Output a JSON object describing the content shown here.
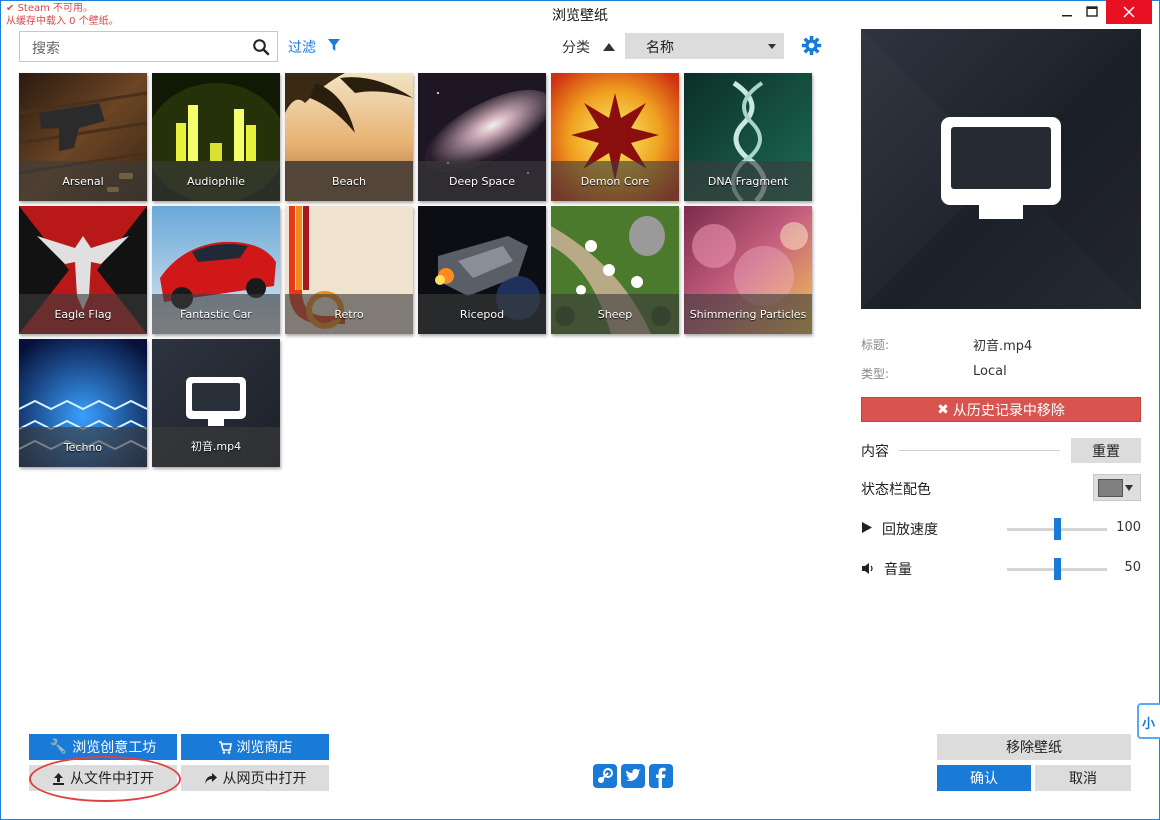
{
  "window": {
    "title": "浏览壁纸",
    "status_line1": "Steam 不可用。",
    "status_line2": "从缓存中载入 0 个壁纸。"
  },
  "toolbar": {
    "search_placeholder": "搜索",
    "filter_label": "过滤",
    "sort_label": "分类",
    "sort_value": "名称"
  },
  "wallpapers": [
    {
      "name": "Arsenal"
    },
    {
      "name": "Audiophile"
    },
    {
      "name": "Beach"
    },
    {
      "name": "Deep Space"
    },
    {
      "name": "Demon Core"
    },
    {
      "name": "DNA Fragment"
    },
    {
      "name": "Eagle Flag"
    },
    {
      "name": "Fantastic Car"
    },
    {
      "name": "Retro"
    },
    {
      "name": "Ricepod"
    },
    {
      "name": "Sheep"
    },
    {
      "name": "Shimmering Particles"
    },
    {
      "name": "Techno"
    },
    {
      "name": "初音.mp4",
      "selected": true
    }
  ],
  "details": {
    "title_label": "标题:",
    "title_value": "初音.mp4",
    "type_label": "类型:",
    "type_value": "Local",
    "remove_history_label": "从历史记录中移除",
    "content_label": "内容",
    "reset_label": "重置",
    "statusbar_color_label": "状态栏配色",
    "statusbar_color": "#808080",
    "playback_speed_label": "回放速度",
    "playback_speed_value": "100",
    "playback_speed_fraction": 0.5,
    "volume_label": "音量",
    "volume_value": "50",
    "volume_fraction": 0.5
  },
  "footer": {
    "workshop_label": "浏览创意工坊",
    "store_label": "浏览商店",
    "open_file_label": "从文件中打开",
    "open_web_label": "从网页中打开",
    "remove_wallpaper_label": "移除壁纸",
    "ok_label": "确认",
    "cancel_label": "取消",
    "side_tab_text": "小"
  },
  "colors": {
    "accent": "#1a7ad8",
    "danger": "#d9534f"
  }
}
